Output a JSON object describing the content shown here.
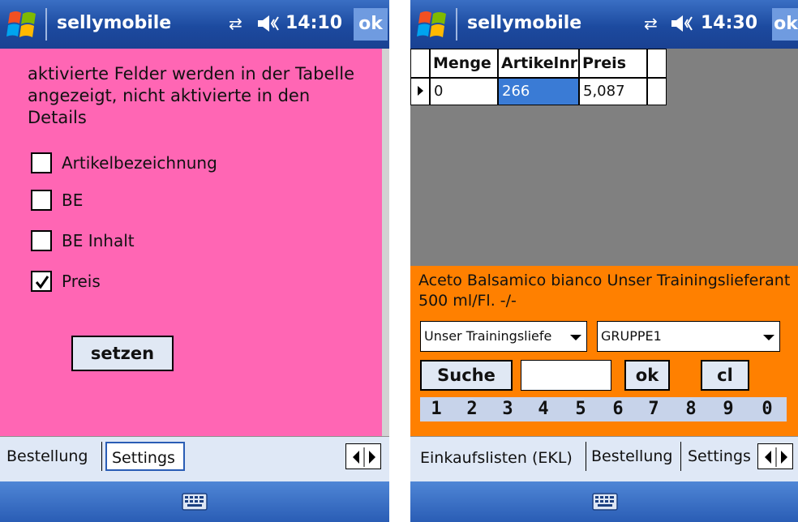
{
  "left": {
    "statusbar": {
      "app_title": "sellymobile",
      "time": "14:10",
      "ok_label": "ok"
    },
    "info_text": "aktivierte Felder werden in der Tabelle angezeigt, nicht aktivierte in den Details",
    "checkboxes": [
      {
        "label": "Artikelbezeichnung",
        "checked": false
      },
      {
        "label": "BE",
        "checked": false
      },
      {
        "label": "BE Inhalt",
        "checked": false
      },
      {
        "label": "Preis",
        "checked": true
      }
    ],
    "setzen_label": "setzen",
    "tabs": [
      {
        "label": "Bestellung",
        "active": false
      },
      {
        "label": "Settings",
        "active": true
      }
    ]
  },
  "right": {
    "statusbar": {
      "app_title": "sellymobile",
      "time": "14:30",
      "ok_label": "ok"
    },
    "grid": {
      "columns": [
        "Menge",
        "Artikelnr",
        "Preis"
      ],
      "rows": [
        [
          "0",
          "266",
          "5,087"
        ]
      ]
    },
    "description": "Aceto Balsamico bianco Unser Trainingslieferant 500 ml/Fl. -/-",
    "supplier_select": "Unser Trainingsliefe",
    "group_select": "GRUPPE1",
    "search_button": "Suche",
    "search_value": "",
    "ok_button": "ok",
    "clear_button": "cl",
    "digits": [
      "1",
      "2",
      "3",
      "4",
      "5",
      "6",
      "7",
      "8",
      "9",
      "0"
    ],
    "tabs": [
      {
        "label": "Einkaufslisten (EKL)",
        "active": true
      },
      {
        "label": "Bestellung",
        "active": false
      },
      {
        "label": "Settings",
        "active": false
      }
    ]
  },
  "icons": [
    "windows-start-icon",
    "connectivity-icon",
    "volume-icon",
    "keyboard-icon",
    "scroll-left-icon",
    "scroll-right-icon",
    "row-pointer-icon",
    "dropdown-arrow-icon"
  ]
}
